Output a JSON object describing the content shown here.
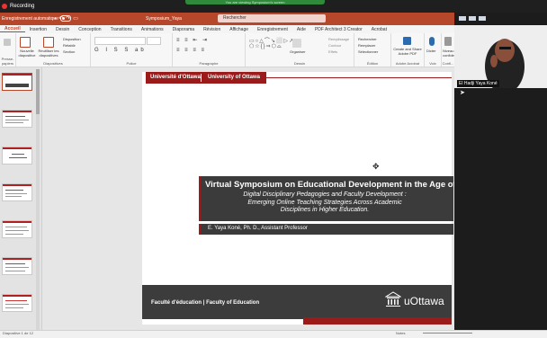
{
  "recording": {
    "label": "Recording"
  },
  "share_banner": {
    "text": "You are viewing Symposium's screen"
  },
  "ppt": {
    "autosave_label": "Enregistrement automatique",
    "doc_name": "Symposium_Yaya",
    "search_placeholder": "Rechercher",
    "accent": "#b7472a"
  },
  "menu": {
    "tabs": [
      "Accueil",
      "Insertion",
      "Dessin",
      "Conception",
      "Transitions",
      "Animations",
      "Diaporama",
      "Révision",
      "Affichage",
      "Enregistrement",
      "Aide",
      "PDF Architect 3 Creator",
      "Acrobat"
    ],
    "active": "Accueil"
  },
  "ribbon": {
    "groups": [
      "Diapositives",
      "Police",
      "Paragraphe",
      "Dessin",
      "Édition",
      "Adobe Acrobat",
      "Voix",
      "Confi..."
    ],
    "slide_new": "Nouvelle diapositive",
    "slide_reuse": "Réutiliser les diapositives",
    "layout": "Disposition",
    "reset": "Rétablir",
    "section": "Section",
    "arrange": "Organiser",
    "fill": "Remplissage",
    "outline": "Contour",
    "effects": "Effets",
    "find": "Rechercher",
    "replace": "Remplacer",
    "select": "Sélectionner",
    "acrobat_btn": "Create and Share Adobe PDF",
    "dictate": "Dicter",
    "sensitivity": "Niveau de confidentialité",
    "clipboard": "Presse-papiers"
  },
  "slide": {
    "logo_fr": "Université d'Ottawa",
    "logo_en": "University of Ottawa",
    "title": "Virtual Symposium on Educational Development in the Age of ICT",
    "subtitle_l1": "Digital Disciplinary Pedagogies and Faculty Development :",
    "subtitle_l2": "Emerging Online Teaching Strategies Across Academic",
    "subtitle_l3": "Disciplines in Higher Education.",
    "author": "E. Yaya Koné, Ph. D., Assistant Professor",
    "footer": "Faculté d'éducation | Faculty of Education",
    "logo_text": "uOttawa"
  },
  "participant": {
    "name": "El Hadji Yaya Koné"
  },
  "status": {
    "left": "Diapositive 1 de 12",
    "right": "Notes"
  }
}
